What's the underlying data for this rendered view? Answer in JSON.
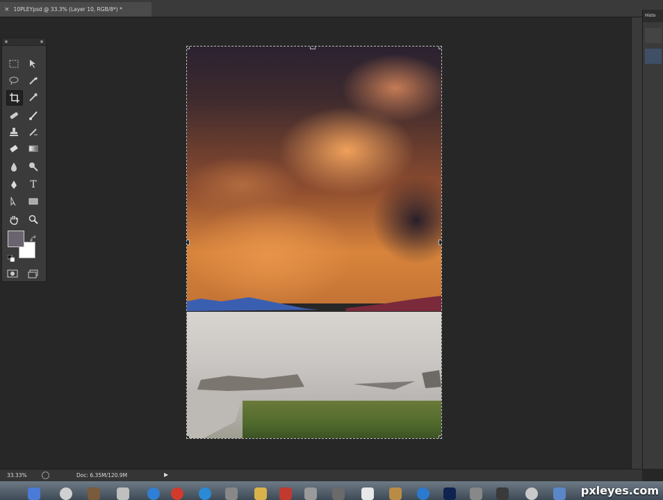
{
  "document_tab": {
    "close_glyph": "×",
    "title": "10PLEYpsd @ 33.3% (Layer 10, RGB/8*) *"
  },
  "toolbox": {
    "tools": [
      {
        "name": "marquee-tool-icon",
        "active": false
      },
      {
        "name": "move-tool-icon",
        "active": false
      },
      {
        "name": "lasso-tool-icon",
        "active": false
      },
      {
        "name": "magic-wand-tool-icon",
        "active": false
      },
      {
        "name": "crop-tool-icon",
        "active": true
      },
      {
        "name": "eyedropper-tool-icon",
        "active": false
      },
      {
        "name": "healing-brush-tool-icon",
        "active": false
      },
      {
        "name": "brush-tool-icon",
        "active": false
      },
      {
        "name": "clone-stamp-tool-icon",
        "active": false
      },
      {
        "name": "history-brush-tool-icon",
        "active": false
      },
      {
        "name": "eraser-tool-icon",
        "active": false
      },
      {
        "name": "gradient-tool-icon",
        "active": false
      },
      {
        "name": "blur-tool-icon",
        "active": false
      },
      {
        "name": "dodge-tool-icon",
        "active": false
      },
      {
        "name": "pen-tool-icon",
        "active": false
      },
      {
        "name": "type-tool-icon",
        "active": false
      },
      {
        "name": "path-selection-tool-icon",
        "active": false
      },
      {
        "name": "rectangle-tool-icon",
        "active": false
      },
      {
        "name": "hand-tool-icon",
        "active": false
      },
      {
        "name": "zoom-tool-icon",
        "active": false
      }
    ],
    "foreground_color": "#6b6470",
    "background_color": "#ffffff",
    "type_glyph": "T"
  },
  "right_panel": {
    "header": "Histo"
  },
  "status_bar": {
    "zoom": "33.33%",
    "doc_info": "Doc: 6.35M/120.9M",
    "arrow": "▶"
  },
  "watermark": "pxleyes.com",
  "colors": {
    "workspace": "#262626",
    "panel": "#3a3a3a",
    "selection_border": "#bdbdbd"
  }
}
